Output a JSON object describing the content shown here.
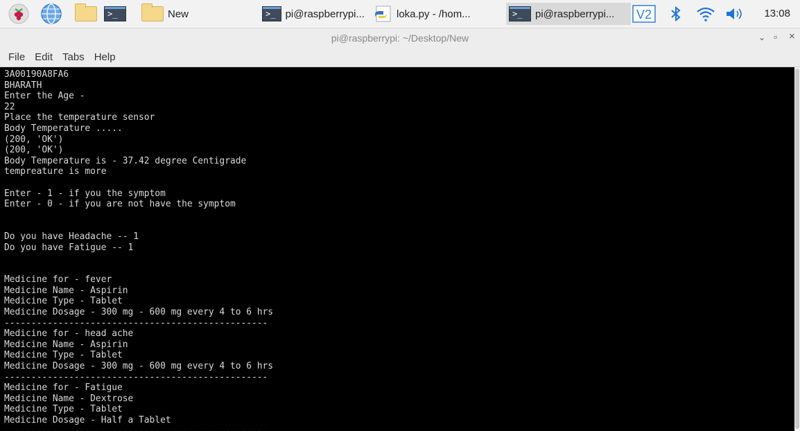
{
  "taskbar": {
    "new_folder_label": "New",
    "tasks": [
      {
        "label": "pi@raspberrypi..."
      },
      {
        "label": "loka.py - /hom..."
      },
      {
        "label": "pi@raspberrypi..."
      }
    ],
    "clock": "13:08",
    "icons": [
      "raspberry-menu-icon",
      "web-browser-icon",
      "file-manager-icon",
      "terminal-icon",
      "folder-icon",
      "vnc-icon",
      "bluetooth-icon",
      "wifi-icon",
      "volume-icon"
    ],
    "colors": {
      "raspberry": "#c51a4a",
      "globe": "#2f7fd6",
      "bluetooth": "#1e73d8",
      "vnc": "#2f7fd6"
    }
  },
  "window": {
    "title": "pi@raspberrypi: ~/Desktop/New",
    "minimize": "⌄",
    "maximize": "▫",
    "close": "×"
  },
  "menu": {
    "items": [
      "File",
      "Edit",
      "Tabs",
      "Help"
    ]
  },
  "terminal": {
    "lines": [
      "3A00190A8FA6",
      "BHARATH",
      "Enter the Age -",
      "22",
      "Place the temperature sensor",
      "Body Temperature .....",
      "(200, 'OK')",
      "(200, 'OK')",
      "Body Temperature is - 37.42 degree Centigrade",
      "tempreature is more",
      "",
      "Enter - 1 - if you the symptom",
      "Enter - 0 - if you are not have the symptom",
      "",
      "",
      "Do you have Headache -- 1",
      "Do you have Fatigue -- 1",
      "",
      "",
      "Medicine for - fever",
      "Medicine Name - Aspirin",
      "Medicine Type - Tablet",
      "Medicine Dosage - 300 mg - 600 mg every 4 to 6 hrs",
      "-------------------------------------------------",
      "Medicine for - head ache",
      "Medicine Name - Aspirin",
      "Medicine Type - Tablet",
      "Medicine Dosage - 300 mg - 600 mg every 4 to 6 hrs",
      "-------------------------------------------------",
      "Medicine for - Fatigue",
      "Medicine Name - Dextrose",
      "Medicine Type - Tablet",
      "Medicine Dosage - Half a Tablet",
      "-------------------------------------------------"
    ],
    "colors": {
      "background": "#000000",
      "foreground": "#d9d9d9"
    }
  }
}
